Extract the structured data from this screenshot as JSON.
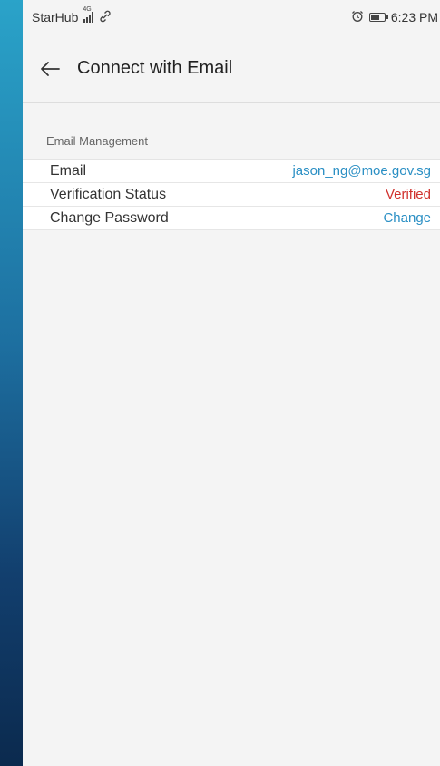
{
  "status_bar": {
    "carrier": "StarHub",
    "network": "4G",
    "time": "6:23 PM"
  },
  "app_bar": {
    "title": "Connect with Email"
  },
  "section": {
    "header": "Email Management"
  },
  "rows": [
    {
      "label": "Email",
      "value": "jason_ng@moe.gov.sg",
      "value_color": "#2a8fc4"
    },
    {
      "label": "Verification Status",
      "value": "Verified",
      "value_color": "#d0312d"
    },
    {
      "label": "Change Password",
      "value": "Change",
      "value_color": "#2a8fc4"
    }
  ],
  "icons": {
    "back": "arrow-left-icon",
    "signal": "signal-icon",
    "wifi": "link-icon",
    "alarm": "alarm-icon",
    "battery": "battery-icon"
  },
  "battery_level_percent": 70
}
